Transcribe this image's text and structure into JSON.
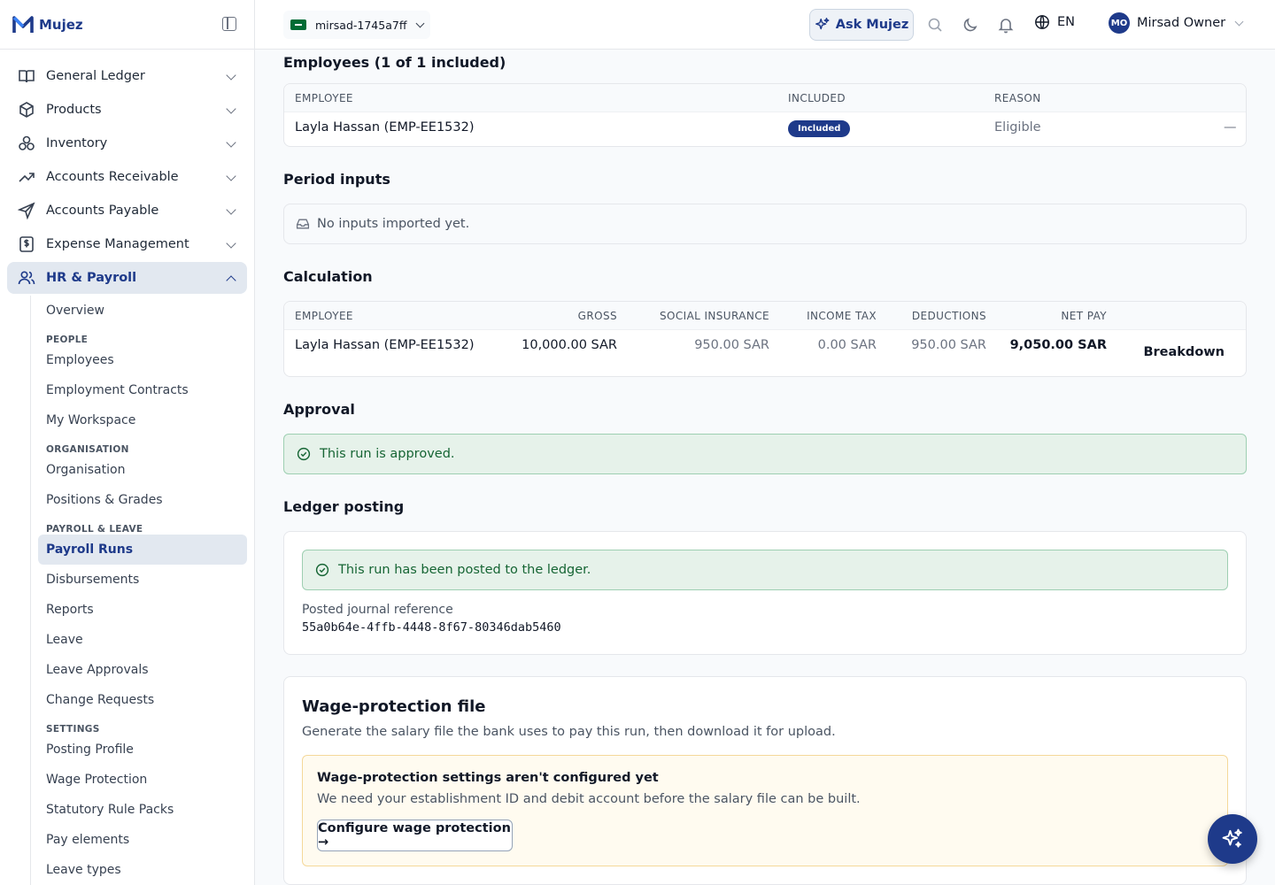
{
  "app": {
    "brand": "Mujez"
  },
  "sidebar": {
    "nav": [
      {
        "label": "General Ledger",
        "icon": "book-icon"
      },
      {
        "label": "Products",
        "icon": "box-icon"
      },
      {
        "label": "Inventory",
        "icon": "boxes-icon"
      },
      {
        "label": "Accounts Receivable",
        "icon": "trending-up-icon"
      },
      {
        "label": "Accounts Payable",
        "icon": "send-icon"
      },
      {
        "label": "Expense Management",
        "icon": "receipt-dollar-icon"
      },
      {
        "label": "HR & Payroll",
        "icon": "users-icon"
      }
    ],
    "sub": {
      "overview": "Overview",
      "cat_people": "PEOPLE",
      "employees": "Employees",
      "employment_contracts": "Employment Contracts",
      "my_workspace": "My Workspace",
      "cat_org": "ORGANISATION",
      "organisation": "Organisation",
      "positions_grades": "Positions & Grades",
      "cat_payroll": "PAYROLL & LEAVE",
      "payroll_runs": "Payroll Runs",
      "disbursements": "Disbursements",
      "reports": "Reports",
      "leave": "Leave",
      "leave_approvals": "Leave Approvals",
      "change_requests": "Change Requests",
      "cat_settings": "SETTINGS",
      "posting_profile": "Posting Profile",
      "wage_protection": "Wage Protection",
      "statutory_rule_packs": "Statutory Rule Packs",
      "pay_elements": "Pay elements",
      "leave_types": "Leave types"
    }
  },
  "topbar": {
    "org": "mirsad-1745a7ff",
    "ask": "Ask Mujez",
    "lang": "EN",
    "user_initials": "MO",
    "user_name": "Mirsad Owner"
  },
  "employees_section": {
    "title": "Employees (1 of 1 included)",
    "headers": {
      "employee": "EMPLOYEE",
      "included": "INCLUDED",
      "reason": "REASON"
    },
    "row": {
      "employee": "Layla Hassan (EMP-EE1532)",
      "included": "Included",
      "reason": "Eligible",
      "action": "—"
    }
  },
  "period_inputs": {
    "title": "Period inputs",
    "empty": "No inputs imported yet."
  },
  "calculation": {
    "title": "Calculation",
    "headers": {
      "employee": "EMPLOYEE",
      "gross": "GROSS",
      "social": "SOCIAL INSURANCE",
      "tax": "INCOME TAX",
      "deductions": "DEDUCTIONS",
      "net": "NET PAY"
    },
    "row": {
      "employee": "Layla Hassan (EMP-EE1532)",
      "gross": "10,000.00 SAR",
      "social": "950.00 SAR",
      "tax": "0.00 SAR",
      "deductions": "950.00 SAR",
      "net": "9,050.00 SAR",
      "breakdown": "Breakdown"
    }
  },
  "approval": {
    "title": "Approval",
    "message": "This run is approved."
  },
  "ledger": {
    "title": "Ledger posting",
    "message": "This run has been posted to the ledger.",
    "ref_label": "Posted journal reference",
    "ref_value": "55a0b64e-4ffb-4448-8f67-80346dab5460"
  },
  "wps": {
    "title": "Wage-protection file",
    "desc": "Generate the salary file the bank uses to pay this run, then download it for upload.",
    "warn_title": "Wage-protection settings aren't configured yet",
    "warn_desc": "We need your establishment ID and debit account before the salary file can be built.",
    "button": "Configure wage protection →"
  },
  "colors": {
    "brand": "#1e3a8a",
    "success_bg": "#e6f2ea",
    "warn_bg": "#fffbf0"
  }
}
